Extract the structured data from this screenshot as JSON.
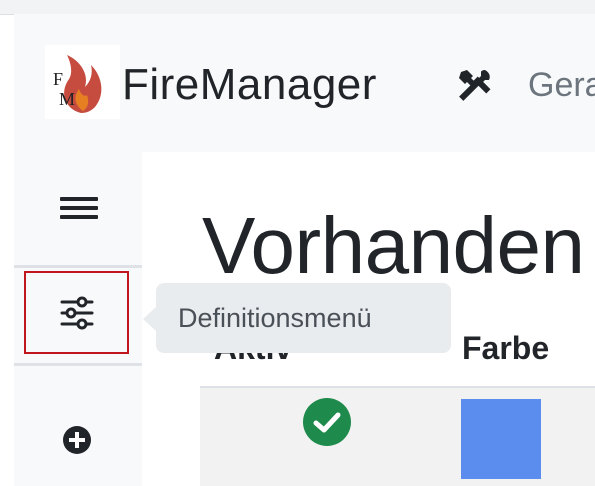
{
  "app": {
    "brand": "FireManager",
    "logo_letters": "FM",
    "nav_link": "Gera"
  },
  "sidebar": {
    "items": [
      {
        "icon": "hamburger-icon"
      },
      {
        "icon": "sliders-icon",
        "tooltip": "Definitionsmenü"
      },
      {
        "icon": "plus-circle-icon"
      }
    ]
  },
  "main": {
    "heading": "Vorhanden",
    "table": {
      "headers": [
        "Aktiv",
        "Farbe"
      ],
      "rows": [
        {
          "aktiv": "check-circle-icon",
          "farbe": "#5b8def"
        }
      ]
    }
  },
  "colors": {
    "accent_red": "#c0161e",
    "check_green": "#1e8a4c",
    "swatch_blue": "#5b8def"
  }
}
